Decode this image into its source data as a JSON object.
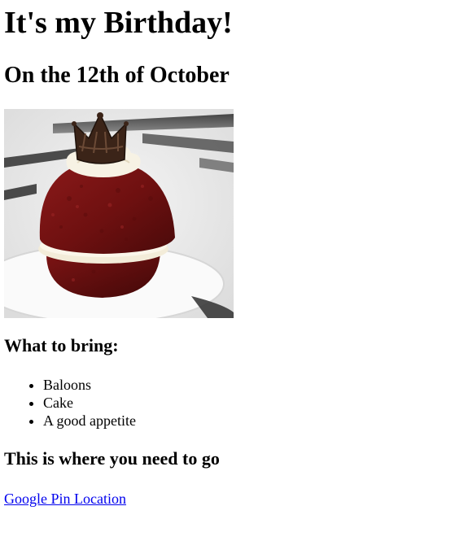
{
  "header": {
    "title": "It's my Birthday!",
    "subtitle": "On the 12th of October"
  },
  "image": {
    "alt": "Red velvet cake"
  },
  "bring": {
    "heading": "What to bring:",
    "items": [
      "Baloons",
      "Cake",
      "A good appetite"
    ]
  },
  "directions": {
    "heading": "This is where you need to go",
    "link_label": "Google Pin Location"
  }
}
